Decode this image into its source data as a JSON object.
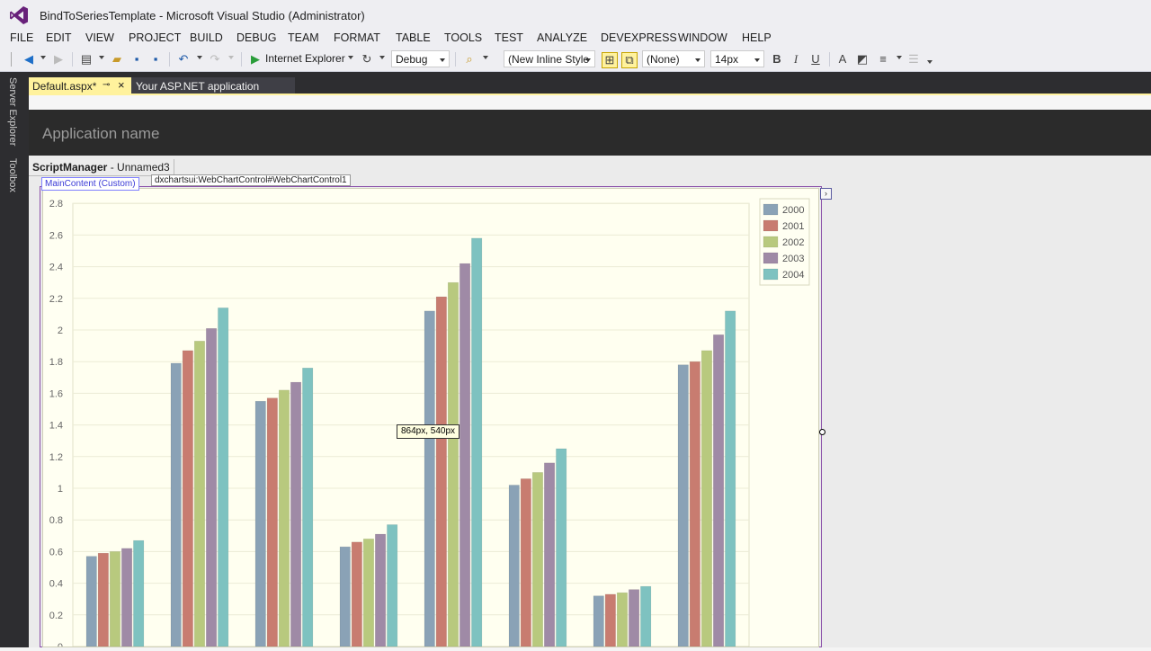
{
  "window": {
    "title": "BindToSeriesTemplate - Microsoft Visual Studio (Administrator)"
  },
  "menu": [
    "FILE",
    "EDIT",
    "VIEW",
    "PROJECT",
    "BUILD",
    "DEBUG",
    "TEAM",
    "FORMAT",
    "TABLE",
    "TOOLS",
    "TEST",
    "ANALYZE",
    "DEVEXPRESS",
    "WINDOW",
    "HELP"
  ],
  "toolbar": {
    "run_label": "Internet Explorer",
    "config_value": "Debug",
    "style_value": "(New Inline Style",
    "target_rule_value": "(None)",
    "font_size_value": "14px",
    "bold_label": "B",
    "italic_label": "I",
    "underline_label": "U"
  },
  "side_tabs": [
    "Server Explorer",
    "Toolbox"
  ],
  "doc_tabs": [
    {
      "label": "Default.aspx*",
      "active": true
    },
    {
      "label": "Your ASP.NET application",
      "active": false
    }
  ],
  "designer": {
    "app_name": "Application name",
    "script_manager_name": "ScriptManager",
    "script_manager_id": " - Unnamed3",
    "main_content_tag": "MainContent (Custom)",
    "web_chart_tag": "dxchartsui:WebChartControl#WebChartControl1",
    "size_tooltip": "864px, 540px",
    "smart_tag_glyph": "›"
  },
  "colors": {
    "active_tab": "#fff29d",
    "dark_chrome": "#2d2d30",
    "selection_border": "#8a4fa8",
    "chart_background": "#fffff2"
  },
  "chart_data": {
    "type": "bar",
    "y_ticks": [
      "0",
      "0.2",
      "0.4",
      "0.6",
      "0.8",
      "1",
      "1.2",
      "1.4",
      "1.6",
      "1.8",
      "2",
      "2.2",
      "2.4",
      "2.6",
      "2.8"
    ],
    "ylim": [
      0,
      2.8
    ],
    "grid": true,
    "legend_position": "top-right",
    "series": [
      {
        "name": "2000",
        "color": "#8aa2b6",
        "values": [
          0.57,
          1.79,
          1.55,
          0.63,
          2.12,
          1.02,
          0.32,
          1.78
        ]
      },
      {
        "name": "2001",
        "color": "#c87c70",
        "values": [
          0.59,
          1.87,
          1.57,
          0.66,
          2.21,
          1.06,
          0.33,
          1.8
        ]
      },
      {
        "name": "2002",
        "color": "#b8c97e",
        "values": [
          0.6,
          1.93,
          1.62,
          0.68,
          2.3,
          1.1,
          0.34,
          1.87
        ]
      },
      {
        "name": "2003",
        "color": "#9f8aa6",
        "values": [
          0.62,
          2.01,
          1.67,
          0.71,
          2.42,
          1.16,
          0.36,
          1.97
        ]
      },
      {
        "name": "2004",
        "color": "#7ec2c0",
        "values": [
          0.67,
          2.14,
          1.76,
          0.77,
          2.58,
          1.25,
          0.38,
          2.12
        ]
      }
    ]
  }
}
